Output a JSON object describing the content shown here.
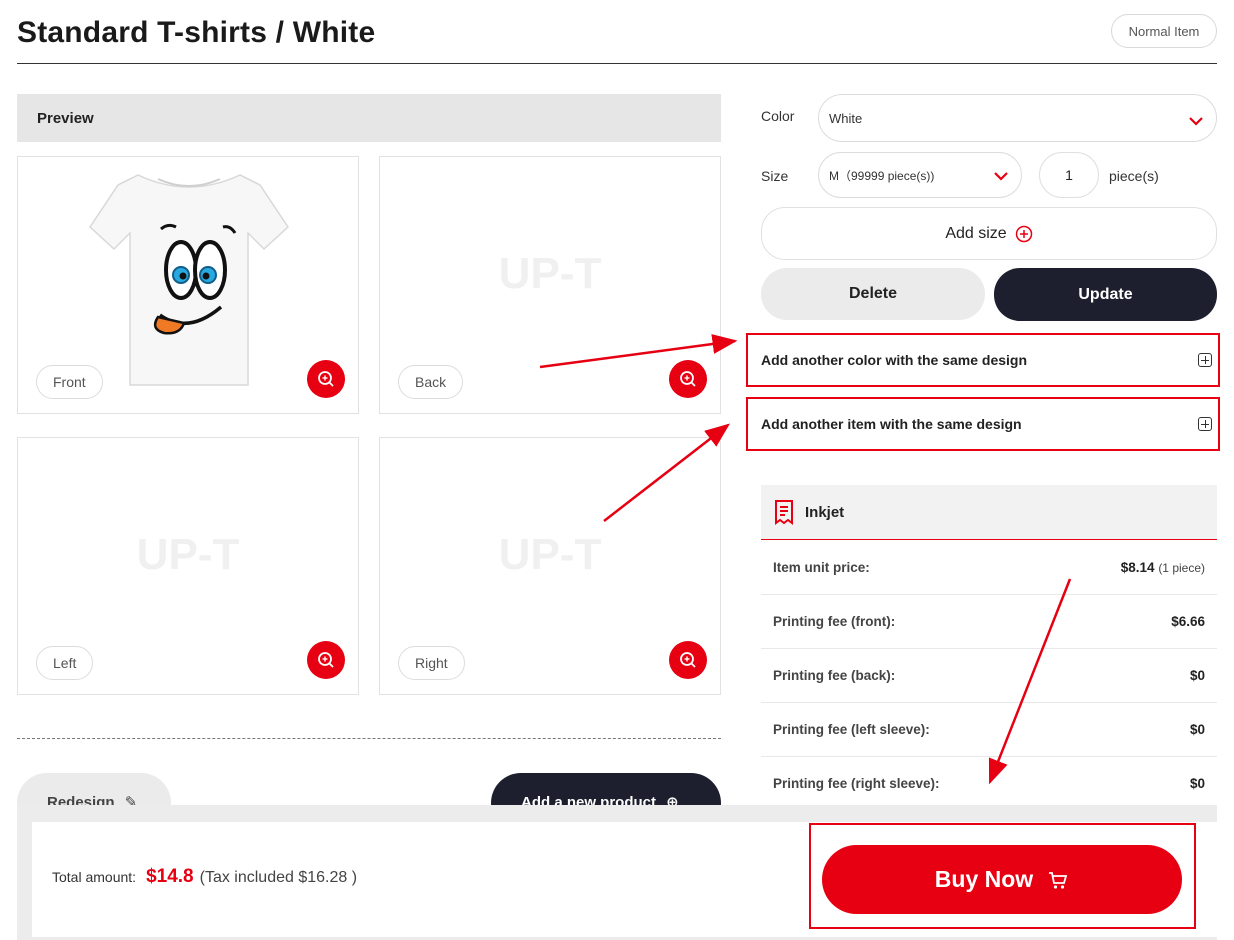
{
  "header": {
    "title": "Standard T-shirts / White",
    "badge": "Normal Item"
  },
  "preview": {
    "heading": "Preview",
    "watermark": "UP-T",
    "views": [
      {
        "label": "Front"
      },
      {
        "label": "Back"
      },
      {
        "label": "Left"
      },
      {
        "label": "Right"
      }
    ]
  },
  "actions": {
    "redesign_label": "Redesign",
    "add_product_label": "Add a new product"
  },
  "options": {
    "color_label": "Color",
    "color_value": "White",
    "size_label": "Size",
    "size_value": "M（99999 piece(s))",
    "quantity": "1",
    "quantity_unit": "piece(s)",
    "add_size_label": "Add size",
    "delete_label": "Delete",
    "update_label": "Update"
  },
  "accordions": {
    "add_color": "Add another color with the same design",
    "add_item": "Add another item with the same design"
  },
  "pricing": {
    "method": "Inkjet",
    "rows": [
      {
        "label": "Item unit price:",
        "value": "$8.14",
        "note": "(1 piece)"
      },
      {
        "label": "Printing fee (front):",
        "value": "$6.66",
        "note": ""
      },
      {
        "label": "Printing fee (back):",
        "value": "$0",
        "note": ""
      },
      {
        "label": "Printing fee (left sleeve):",
        "value": "$0",
        "note": ""
      },
      {
        "label": "Printing fee (right sleeve):",
        "value": "$0",
        "note": ""
      }
    ]
  },
  "footer": {
    "total_label": "Total amount:",
    "total_amount": "$14.8",
    "tax_text": "(Tax included $16.28 )",
    "buy_label": "Buy Now"
  },
  "colors": {
    "accent_red": "#e60012",
    "dark_button": "#1d1f2e",
    "light_panel": "#e6e6e6"
  }
}
